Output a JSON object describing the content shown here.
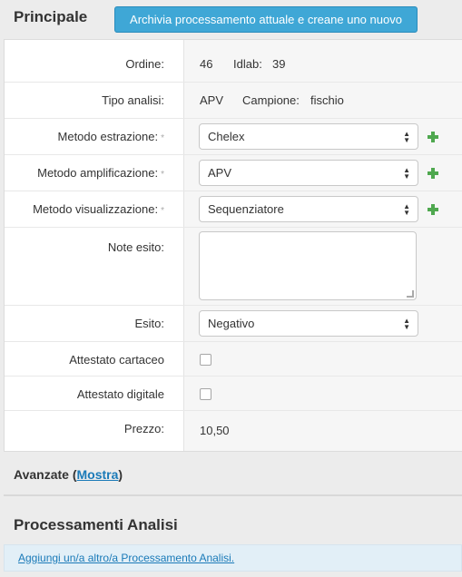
{
  "header": {
    "title": "Principale",
    "archive_button": "Archivia processamento attuale e creane uno nuovo"
  },
  "form": {
    "ordine": {
      "label": "Ordine:",
      "value": "46",
      "idlab_label": "Idlab:",
      "idlab_value": "39"
    },
    "tipo_analisi": {
      "label": "Tipo analisi:",
      "value": "APV",
      "campione_label": "Campione:",
      "campione_value": "fischio"
    },
    "metodo_estrazione": {
      "label": "Metodo estrazione:",
      "required": "*",
      "selected": "Chelex"
    },
    "metodo_amplificazione": {
      "label": "Metodo amplificazione:",
      "required": "*",
      "selected": "APV"
    },
    "metodo_visualizzazione": {
      "label": "Metodo visualizzazione:",
      "required": "*",
      "selected": "Sequenziatore"
    },
    "note_esito": {
      "label": "Note esito:",
      "value": ""
    },
    "esito": {
      "label": "Esito:",
      "selected": "Negativo"
    },
    "attestato_cartaceo": {
      "label": "Attestato cartaceo",
      "checked": false
    },
    "attestato_digitale": {
      "label": "Attestato digitale",
      "checked": false
    },
    "prezzo": {
      "label": "Prezzo:",
      "value": "10,50"
    }
  },
  "avanzate": {
    "label": "Avanzate (",
    "link": "Mostra",
    "close": ")"
  },
  "processamenti": {
    "title": "Processamenti Analisi",
    "add_link": "Aggiungi un/a altro/a Processamento Analisi."
  },
  "colors": {
    "accent": "#3fa7d6",
    "link": "#1a7ab8",
    "plus": "#4fa84f"
  },
  "icons": {
    "add": "plus-icon",
    "select": "select-arrows-icon"
  }
}
